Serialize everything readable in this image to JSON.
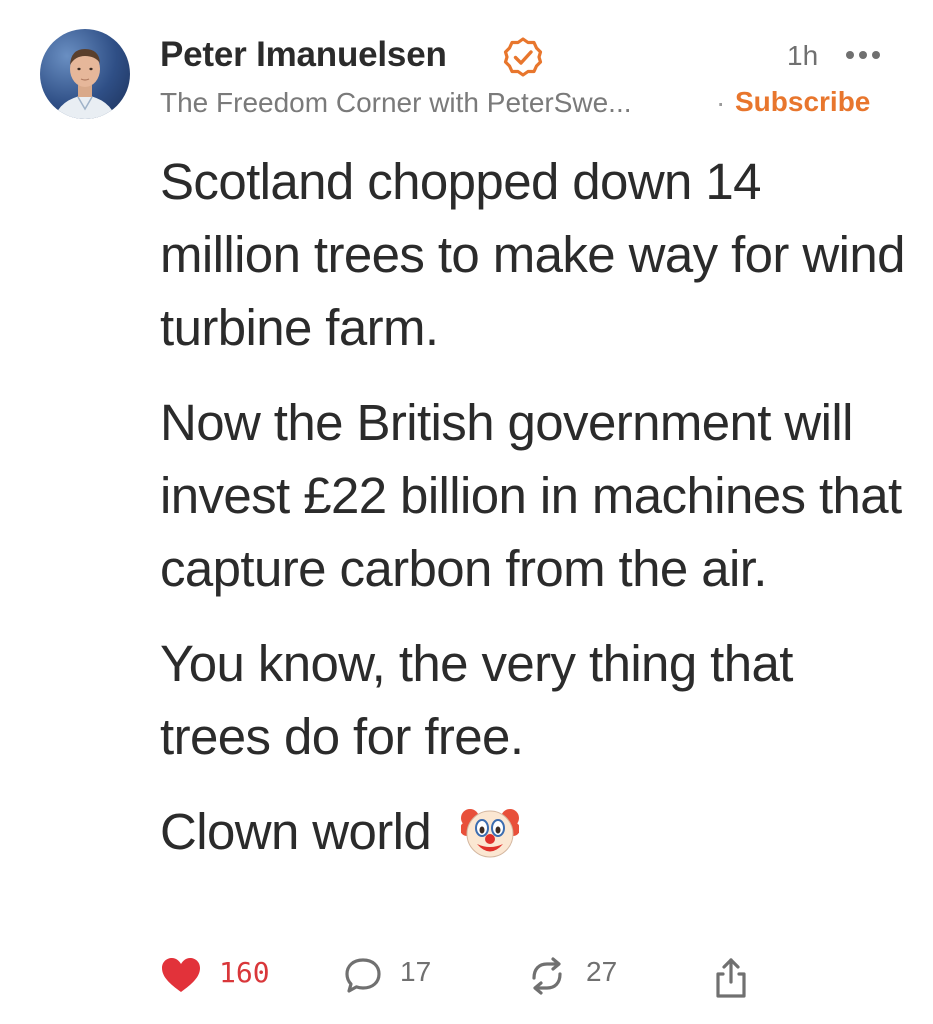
{
  "post": {
    "author": "Peter Imanuelsen",
    "time": "1h",
    "publication": "The Freedom Corner with PeterSwe...",
    "separator": "·",
    "subscribe_label": "Subscribe",
    "paragraphs": [
      "Scotland chopped down 14 million trees to make way for wind turbine farm.",
      "Now the British government will invest £22 billion in machines that capture carbon from the air.",
      "You know, the very thing that trees do for free."
    ],
    "last_line": "Clown world"
  },
  "actions": {
    "likes": "160",
    "comments": "17",
    "restacks": "27"
  },
  "icons": {
    "verified": "verified-badge-icon",
    "more": "more-icon",
    "clown": "clown-face-icon",
    "like": "heart-icon",
    "comment": "comment-bubble-icon",
    "restack": "restack-icon",
    "share": "share-icon"
  },
  "colors": {
    "accent": "#e8762d",
    "like": "#d9373a",
    "text": "#2b2b2b",
    "muted": "#7a7a7a"
  }
}
